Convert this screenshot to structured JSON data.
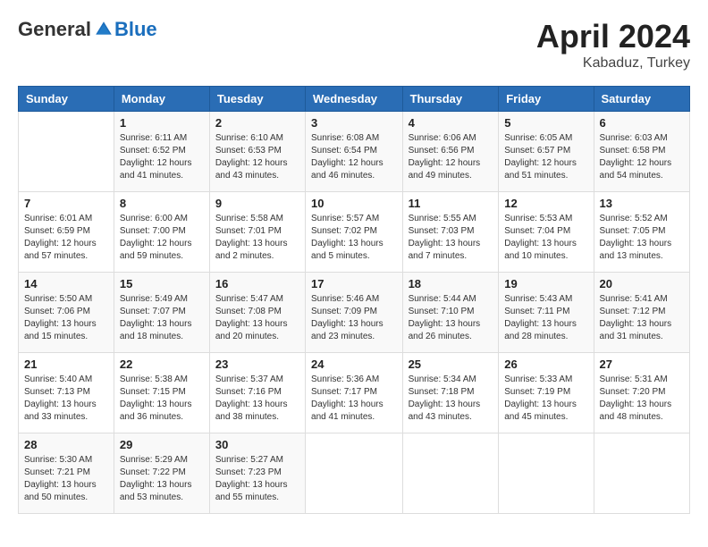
{
  "header": {
    "logo": {
      "general": "General",
      "blue": "Blue"
    },
    "title": "April 2024",
    "location": "Kabaduz, Turkey"
  },
  "weekdays": [
    "Sunday",
    "Monday",
    "Tuesday",
    "Wednesday",
    "Thursday",
    "Friday",
    "Saturday"
  ],
  "weeks": [
    [
      {
        "day": "",
        "info": ""
      },
      {
        "day": "1",
        "info": "Sunrise: 6:11 AM\nSunset: 6:52 PM\nDaylight: 12 hours\nand 41 minutes."
      },
      {
        "day": "2",
        "info": "Sunrise: 6:10 AM\nSunset: 6:53 PM\nDaylight: 12 hours\nand 43 minutes."
      },
      {
        "day": "3",
        "info": "Sunrise: 6:08 AM\nSunset: 6:54 PM\nDaylight: 12 hours\nand 46 minutes."
      },
      {
        "day": "4",
        "info": "Sunrise: 6:06 AM\nSunset: 6:56 PM\nDaylight: 12 hours\nand 49 minutes."
      },
      {
        "day": "5",
        "info": "Sunrise: 6:05 AM\nSunset: 6:57 PM\nDaylight: 12 hours\nand 51 minutes."
      },
      {
        "day": "6",
        "info": "Sunrise: 6:03 AM\nSunset: 6:58 PM\nDaylight: 12 hours\nand 54 minutes."
      }
    ],
    [
      {
        "day": "7",
        "info": "Sunrise: 6:01 AM\nSunset: 6:59 PM\nDaylight: 12 hours\nand 57 minutes."
      },
      {
        "day": "8",
        "info": "Sunrise: 6:00 AM\nSunset: 7:00 PM\nDaylight: 12 hours\nand 59 minutes."
      },
      {
        "day": "9",
        "info": "Sunrise: 5:58 AM\nSunset: 7:01 PM\nDaylight: 13 hours\nand 2 minutes."
      },
      {
        "day": "10",
        "info": "Sunrise: 5:57 AM\nSunset: 7:02 PM\nDaylight: 13 hours\nand 5 minutes."
      },
      {
        "day": "11",
        "info": "Sunrise: 5:55 AM\nSunset: 7:03 PM\nDaylight: 13 hours\nand 7 minutes."
      },
      {
        "day": "12",
        "info": "Sunrise: 5:53 AM\nSunset: 7:04 PM\nDaylight: 13 hours\nand 10 minutes."
      },
      {
        "day": "13",
        "info": "Sunrise: 5:52 AM\nSunset: 7:05 PM\nDaylight: 13 hours\nand 13 minutes."
      }
    ],
    [
      {
        "day": "14",
        "info": "Sunrise: 5:50 AM\nSunset: 7:06 PM\nDaylight: 13 hours\nand 15 minutes."
      },
      {
        "day": "15",
        "info": "Sunrise: 5:49 AM\nSunset: 7:07 PM\nDaylight: 13 hours\nand 18 minutes."
      },
      {
        "day": "16",
        "info": "Sunrise: 5:47 AM\nSunset: 7:08 PM\nDaylight: 13 hours\nand 20 minutes."
      },
      {
        "day": "17",
        "info": "Sunrise: 5:46 AM\nSunset: 7:09 PM\nDaylight: 13 hours\nand 23 minutes."
      },
      {
        "day": "18",
        "info": "Sunrise: 5:44 AM\nSunset: 7:10 PM\nDaylight: 13 hours\nand 26 minutes."
      },
      {
        "day": "19",
        "info": "Sunrise: 5:43 AM\nSunset: 7:11 PM\nDaylight: 13 hours\nand 28 minutes."
      },
      {
        "day": "20",
        "info": "Sunrise: 5:41 AM\nSunset: 7:12 PM\nDaylight: 13 hours\nand 31 minutes."
      }
    ],
    [
      {
        "day": "21",
        "info": "Sunrise: 5:40 AM\nSunset: 7:13 PM\nDaylight: 13 hours\nand 33 minutes."
      },
      {
        "day": "22",
        "info": "Sunrise: 5:38 AM\nSunset: 7:15 PM\nDaylight: 13 hours\nand 36 minutes."
      },
      {
        "day": "23",
        "info": "Sunrise: 5:37 AM\nSunset: 7:16 PM\nDaylight: 13 hours\nand 38 minutes."
      },
      {
        "day": "24",
        "info": "Sunrise: 5:36 AM\nSunset: 7:17 PM\nDaylight: 13 hours\nand 41 minutes."
      },
      {
        "day": "25",
        "info": "Sunrise: 5:34 AM\nSunset: 7:18 PM\nDaylight: 13 hours\nand 43 minutes."
      },
      {
        "day": "26",
        "info": "Sunrise: 5:33 AM\nSunset: 7:19 PM\nDaylight: 13 hours\nand 45 minutes."
      },
      {
        "day": "27",
        "info": "Sunrise: 5:31 AM\nSunset: 7:20 PM\nDaylight: 13 hours\nand 48 minutes."
      }
    ],
    [
      {
        "day": "28",
        "info": "Sunrise: 5:30 AM\nSunset: 7:21 PM\nDaylight: 13 hours\nand 50 minutes."
      },
      {
        "day": "29",
        "info": "Sunrise: 5:29 AM\nSunset: 7:22 PM\nDaylight: 13 hours\nand 53 minutes."
      },
      {
        "day": "30",
        "info": "Sunrise: 5:27 AM\nSunset: 7:23 PM\nDaylight: 13 hours\nand 55 minutes."
      },
      {
        "day": "",
        "info": ""
      },
      {
        "day": "",
        "info": ""
      },
      {
        "day": "",
        "info": ""
      },
      {
        "day": "",
        "info": ""
      }
    ]
  ]
}
